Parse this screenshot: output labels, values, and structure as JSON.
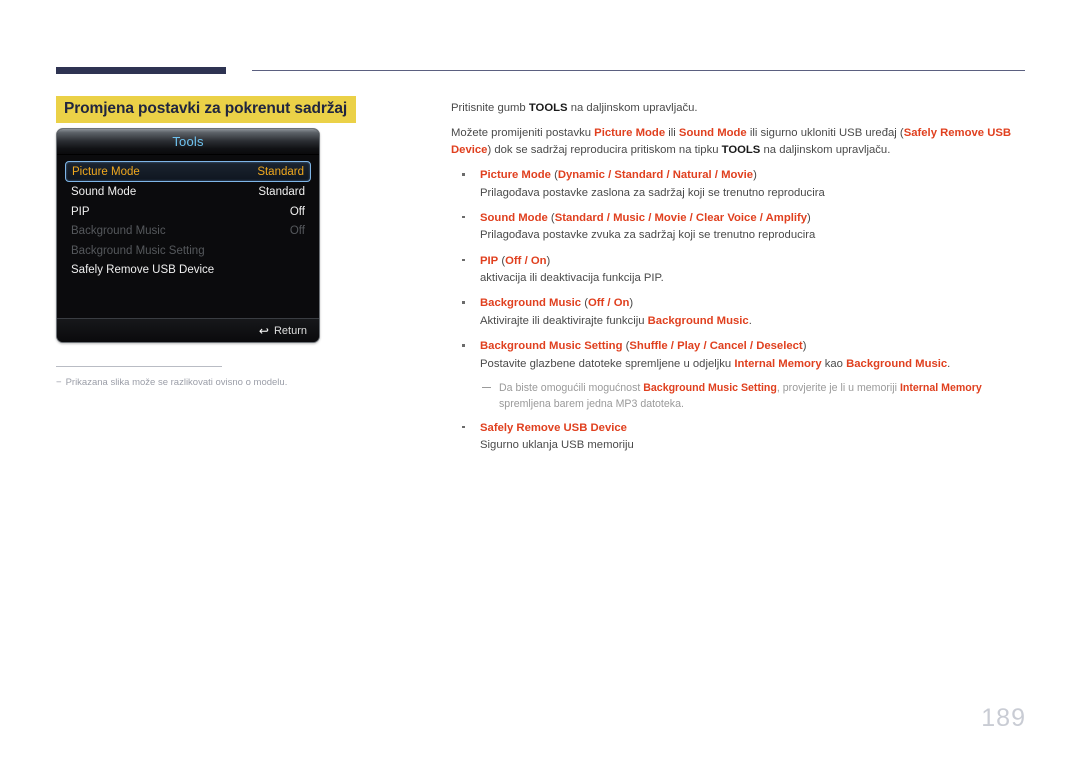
{
  "header": {
    "bar_color": "#2e3352",
    "rule_color": "#5b6080"
  },
  "section": {
    "title": "Promjena postavki za pokrenut sadržaj",
    "highlight_color": "#ebd147"
  },
  "osd": {
    "title": "Tools",
    "rows": [
      {
        "label": "Picture Mode",
        "value": "Standard",
        "state": "selected"
      },
      {
        "label": "Sound Mode",
        "value": "Standard",
        "state": "normal"
      },
      {
        "label": "PIP",
        "value": "Off",
        "state": "normal"
      },
      {
        "label": "Background Music",
        "value": "Off",
        "state": "disabled"
      },
      {
        "label": "Background Music Setting",
        "value": "",
        "state": "disabled"
      },
      {
        "label": "Safely Remove USB Device",
        "value": "",
        "state": "normal"
      }
    ],
    "footer": {
      "return_label": "Return",
      "return_icon": "return-arrow-icon",
      "icon_glyph": "↩"
    },
    "accent_selected": "#f0a81e",
    "accent_title": "#6fc3f0"
  },
  "image_footnote": {
    "dash": "−",
    "text": "Prikazana slika može se razlikovati ovisno o modelu."
  },
  "content": {
    "intro_1": {
      "pre": "Pritisnite gumb ",
      "key": "TOOLS",
      "post": " na daljinskom upravljaču."
    },
    "intro_2": {
      "p1": "Možete promijeniti postavku ",
      "r1": "Picture Mode",
      "p2": " ili ",
      "r2": "Sound Mode",
      "p3": " ili sigurno ukloniti USB uređaj (",
      "r3": "Safely Remove USB Device",
      "p4": ") dok se sadržaj reproducira pritiskom na tipku ",
      "k1": "TOOLS",
      "p5": " na daljinskom upravljaču."
    },
    "bullets": [
      {
        "name": "Picture Mode",
        "options": "(Dynamic / Standard / Natural / Movie)",
        "opt_open": "(",
        "opt_items": "Dynamic / Standard / Natural / Movie",
        "opt_close": ")",
        "desc": "Prilagođava postavke zaslona za sadržaj koji se trenutno reproducira"
      },
      {
        "name": "Sound Mode",
        "opt_open": "(",
        "opt_items": "Standard / Music / Movie / Clear Voice / Amplify",
        "opt_close": ")",
        "desc": "Prilagođava postavke zvuka za sadržaj koji se trenutno reproducira"
      },
      {
        "name": "PIP",
        "opt_open": "(",
        "opt_items": "Off / On",
        "opt_close": ")",
        "desc": "aktivacija ili deaktivacija funkcija PIP."
      },
      {
        "name": "Background Music",
        "opt_open": "(",
        "opt_items": "Off / On",
        "opt_close": ")",
        "desc_pre": "Aktivirajte ili deaktivirajte funkciju ",
        "desc_red": "Background Music",
        "desc_post": "."
      },
      {
        "name": "Background Music Setting",
        "opt_open": "(",
        "opt_items": "Shuffle / Play / Cancel / Deselect",
        "opt_close": ")",
        "desc_pre": "Postavite glazbene datoteke spremljene u odjeljku ",
        "desc_red1": "Internal Memory",
        "desc_mid": " kao ",
        "desc_red2": "Background Music",
        "desc_post": "."
      },
      {
        "name": "Safely Remove USB Device",
        "desc": "Sigurno uklanja USB memoriju"
      }
    ],
    "note": {
      "p1": "Da biste omogućili mogućnost ",
      "r1": "Background Music Setting",
      "p2": ", provjerite je li u memoriji ",
      "r2": "Internal Memory",
      "p3": " spremljena barem jedna MP3 datoteka."
    }
  },
  "page_number": "189",
  "colors": {
    "red_accent": "#e0401f",
    "navy": "#2e3352",
    "yellow": "#ebd147",
    "page_number": "#c9ccd4"
  }
}
